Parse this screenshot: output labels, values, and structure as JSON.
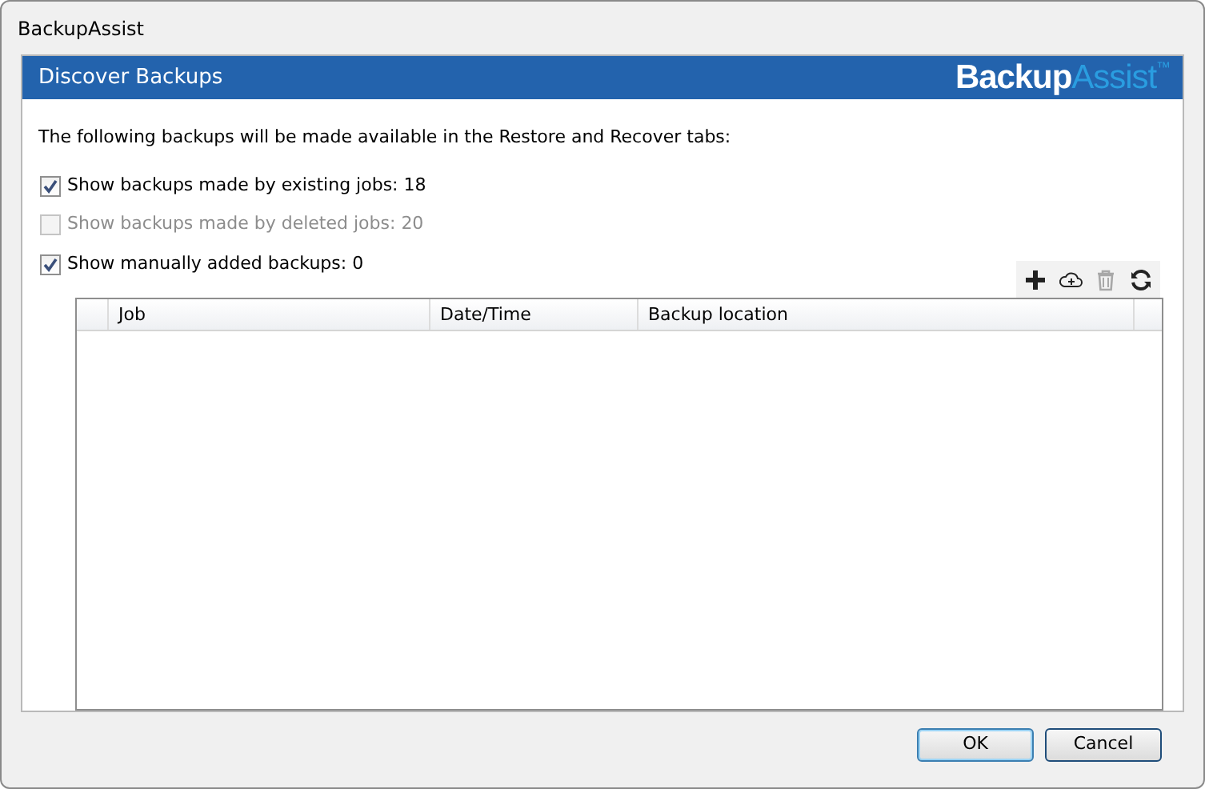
{
  "window": {
    "title": "BackupAssist"
  },
  "header": {
    "title": "Discover Backups",
    "logo": {
      "primary": "Backup",
      "secondary": "Assist",
      "mark": "™"
    }
  },
  "intro": "The following backups will be made available in the Restore and Recover tabs:",
  "options": [
    {
      "label": "Show backups made by existing jobs: 18",
      "checked": true,
      "disabled": false
    },
    {
      "label": "Show backups made by deleted jobs: 20",
      "checked": false,
      "disabled": true
    },
    {
      "label": "Show manually added backups: 0",
      "checked": true,
      "disabled": false
    }
  ],
  "toolbar": [
    {
      "kind": "add",
      "disabled": false
    },
    {
      "kind": "cloud-add",
      "disabled": false
    },
    {
      "kind": "delete",
      "disabled": true
    },
    {
      "kind": "refresh",
      "disabled": false
    }
  ],
  "table": {
    "columns": [
      "Job",
      "Date/Time",
      "Backup location"
    ]
  },
  "buttons": [
    {
      "label": "OK",
      "default": true
    },
    {
      "label": "Cancel",
      "default": false
    }
  ]
}
